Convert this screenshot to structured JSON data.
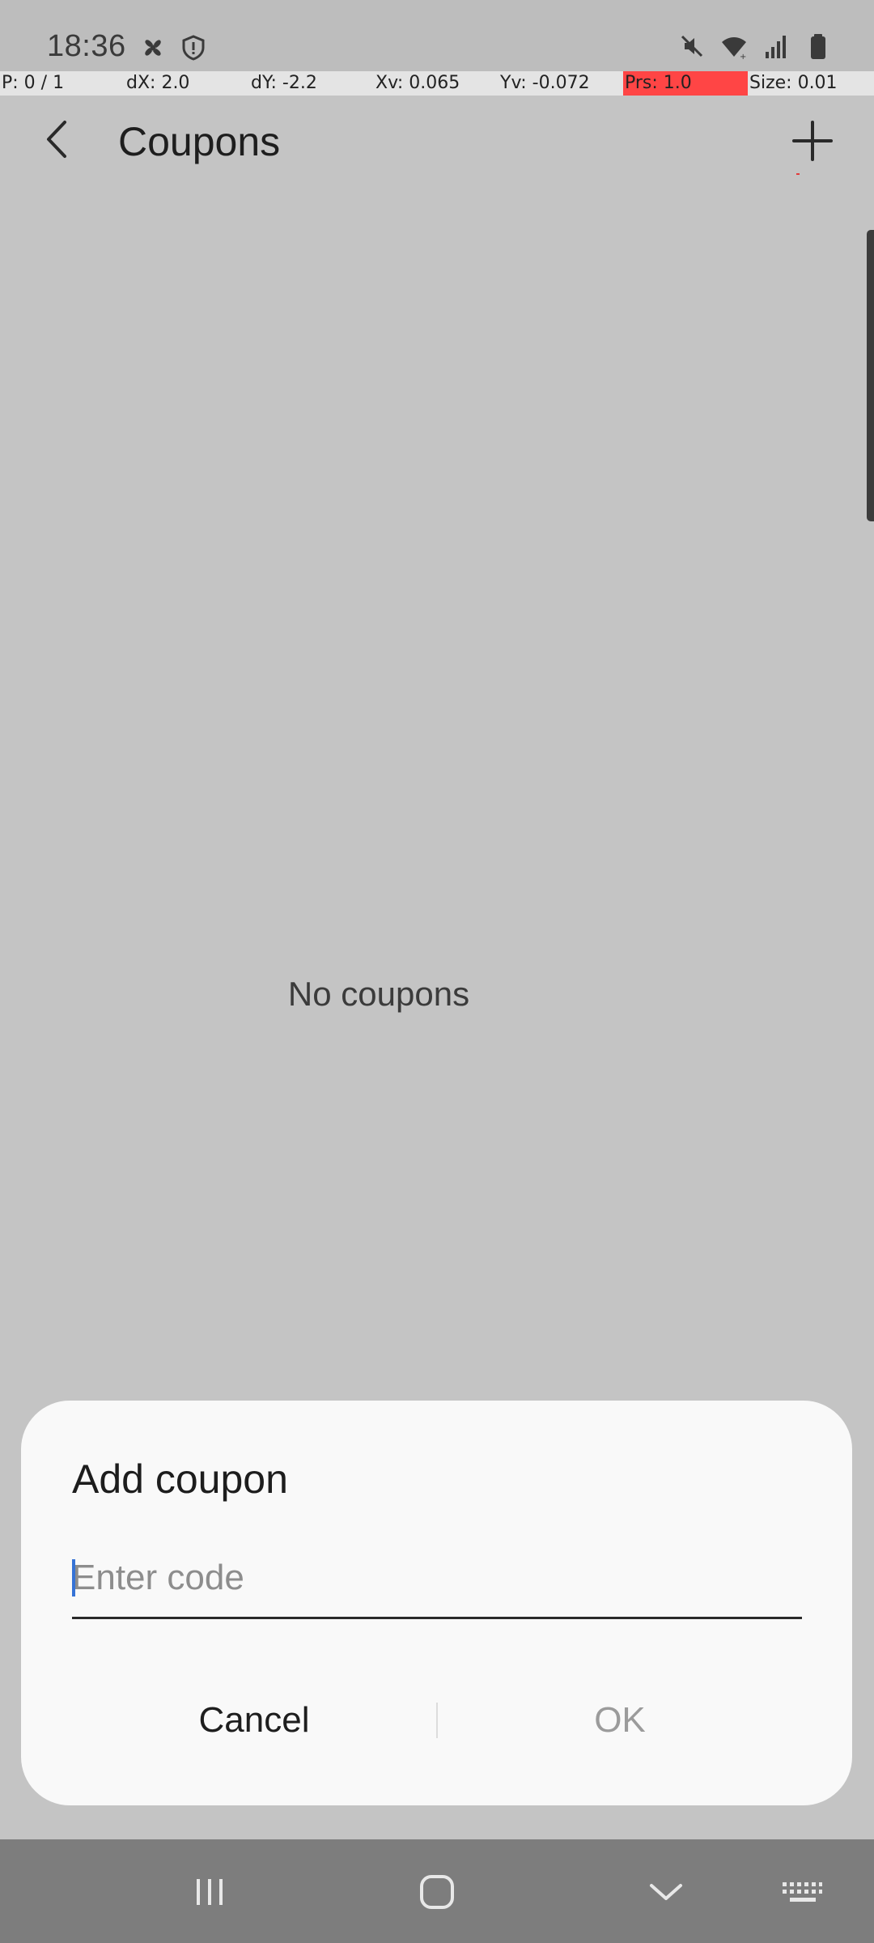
{
  "status_bar": {
    "time": "18:36",
    "left_icons": [
      "fan-icon",
      "shield-alert-icon"
    ],
    "right_icons": [
      "mute-icon",
      "wifi-icon",
      "signal-icon",
      "battery-icon"
    ]
  },
  "debug_overlay": {
    "pointer": "P: 0 / 1",
    "dx": "dX: 2.0",
    "dy": "dY: -2.2",
    "xv": "Xv: 0.065",
    "yv": "Yv: -0.072",
    "prs": "Prs: 1.0",
    "size": "Size: 0.01"
  },
  "app_bar": {
    "title": "Coupons",
    "back_icon": "back-arrow-icon",
    "add_icon": "plus-icon"
  },
  "content": {
    "empty_message": "No coupons"
  },
  "dialog": {
    "title": "Add coupon",
    "input_value": "",
    "input_placeholder": "Enter code",
    "cancel_label": "Cancel",
    "ok_label": "OK"
  },
  "nav_bar": {
    "icons": [
      "recents-icon",
      "home-icon",
      "hide-keyboard-icon",
      "keyboard-icon"
    ]
  },
  "colors": {
    "scrim_background": "#c4c4c4",
    "dialog_background": "#f9f9f9",
    "caret": "#3673d6",
    "disabled_text": "#9b9b9b",
    "debug_alert": "#ff4545"
  }
}
